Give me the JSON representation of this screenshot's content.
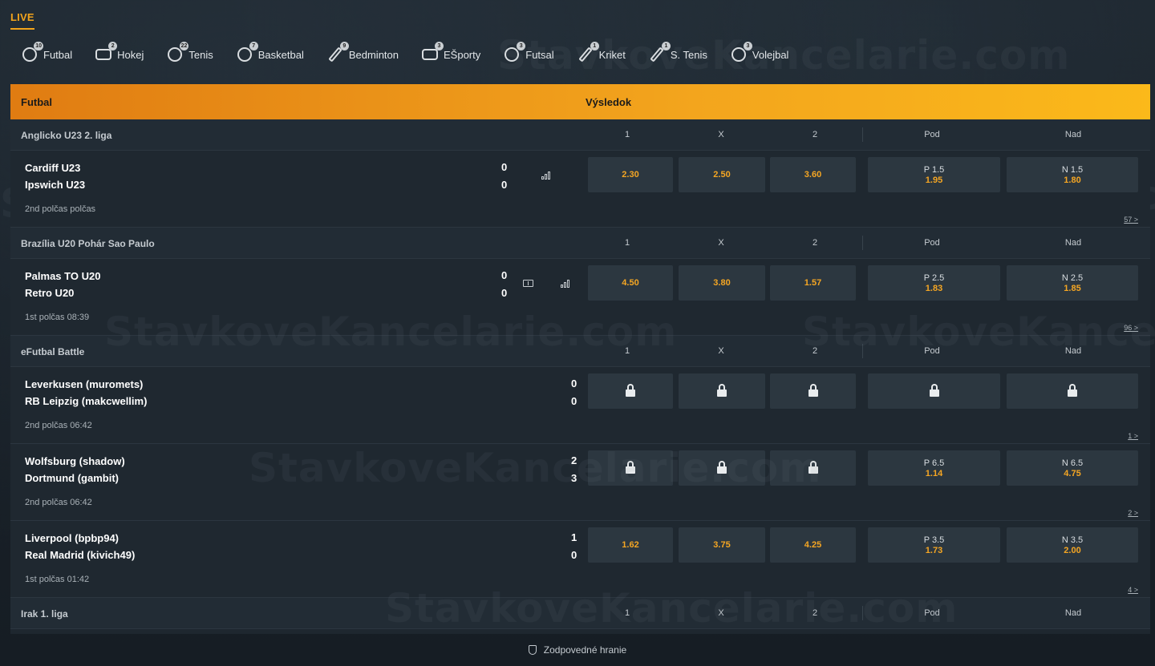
{
  "live_label": "LIVE",
  "sports_nav": [
    {
      "name": "Futbal",
      "count": "10",
      "icon": "soccer-ball-icon"
    },
    {
      "name": "Hokej",
      "count": "2",
      "icon": "hockey-puck-icon"
    },
    {
      "name": "Tenis",
      "count": "22",
      "icon": "tennis-ball-icon"
    },
    {
      "name": "Basketbal",
      "count": "7",
      "icon": "basketball-icon"
    },
    {
      "name": "Bedminton",
      "count": "9",
      "icon": "shuttlecock-icon"
    },
    {
      "name": "EŠporty",
      "count": "3",
      "icon": "gamepad-icon"
    },
    {
      "name": "Futsal",
      "count": "3",
      "icon": "futsal-ball-icon"
    },
    {
      "name": "Kriket",
      "count": "1",
      "icon": "cricket-bat-icon"
    },
    {
      "name": "S. Tenis",
      "count": "1",
      "icon": "table-tennis-icon"
    },
    {
      "name": "Volejbal",
      "count": "3",
      "icon": "volleyball-icon"
    }
  ],
  "header": {
    "sport": "Futbal",
    "result": "Výsledok"
  },
  "col_labels": {
    "one": "1",
    "x": "X",
    "two": "2",
    "pod": "Pod",
    "nad": "Nad"
  },
  "leagues": [
    {
      "name": "Anglicko U23 2. liga",
      "matches": [
        {
          "home": "Cardiff U23",
          "away": "Ipswich U23",
          "home_score": "0",
          "away_score": "0",
          "period": "2nd polčas  polčas",
          "odds": [
            "2.30",
            "2.50",
            "3.60"
          ],
          "pod_line": "P 1.5",
          "pod_price": "1.95",
          "nad_line": "N 1.5",
          "nad_price": "1.80",
          "more": "57 >"
        }
      ]
    },
    {
      "name": "Brazília U20 Pohár Sao Paulo",
      "matches": [
        {
          "home": "Palmas TO U20",
          "away": "Retro U20",
          "home_score": "0",
          "away_score": "0",
          "period": "1st polčas  08:39",
          "odds": [
            "4.50",
            "3.80",
            "1.57"
          ],
          "pod_line": "P 2.5",
          "pod_price": "1.83",
          "nad_line": "N 2.5",
          "nad_price": "1.85",
          "more": "96 >"
        }
      ]
    },
    {
      "name": "eFutbal Battle",
      "matches": [
        {
          "home": "Leverkusen (muromets)",
          "away": "RB Leipzig (makcwellim)",
          "home_score": "0",
          "away_score": "0",
          "period": "2nd polčas  06:42",
          "more": "1 >"
        },
        {
          "home": "Wolfsburg (shadow)",
          "away": "Dortmund (gambit)",
          "home_score": "2",
          "away_score": "3",
          "period": "2nd polčas  06:42",
          "pod_line": "P 6.5",
          "pod_price": "1.14",
          "nad_line": "N 6.5",
          "nad_price": "4.75",
          "more": "2 >"
        },
        {
          "home": "Liverpool (bpbp94)",
          "away": "Real Madrid (kivich49)",
          "home_score": "1",
          "away_score": "0",
          "period": "1st polčas  01:42",
          "odds": [
            "1.62",
            "3.75",
            "4.25"
          ],
          "pod_line": "P 3.5",
          "pod_price": "1.73",
          "nad_line": "N 3.5",
          "nad_price": "2.00",
          "more": "4 >"
        }
      ]
    },
    {
      "name": "Irak 1. liga"
    }
  ],
  "footer": "Zodpovedné hranie",
  "watermark": "StavkoveKancelarie.com"
}
